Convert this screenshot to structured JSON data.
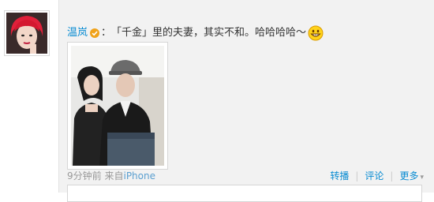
{
  "post": {
    "author": "温岚",
    "colon": "：",
    "text": "「千金」里的夫妻，其实不和。哈哈哈哈～",
    "time": "9分钟前",
    "source_prefix": "来自",
    "source": "iPhone",
    "emoji": "grin-emoji"
  },
  "actions": {
    "repost": "转播",
    "comment": "评论",
    "more": "更多",
    "more_caret": "▾"
  },
  "colors": {
    "link": "#0a8cd2",
    "card_bg": "#f2f2f2",
    "meta": "#999999"
  }
}
